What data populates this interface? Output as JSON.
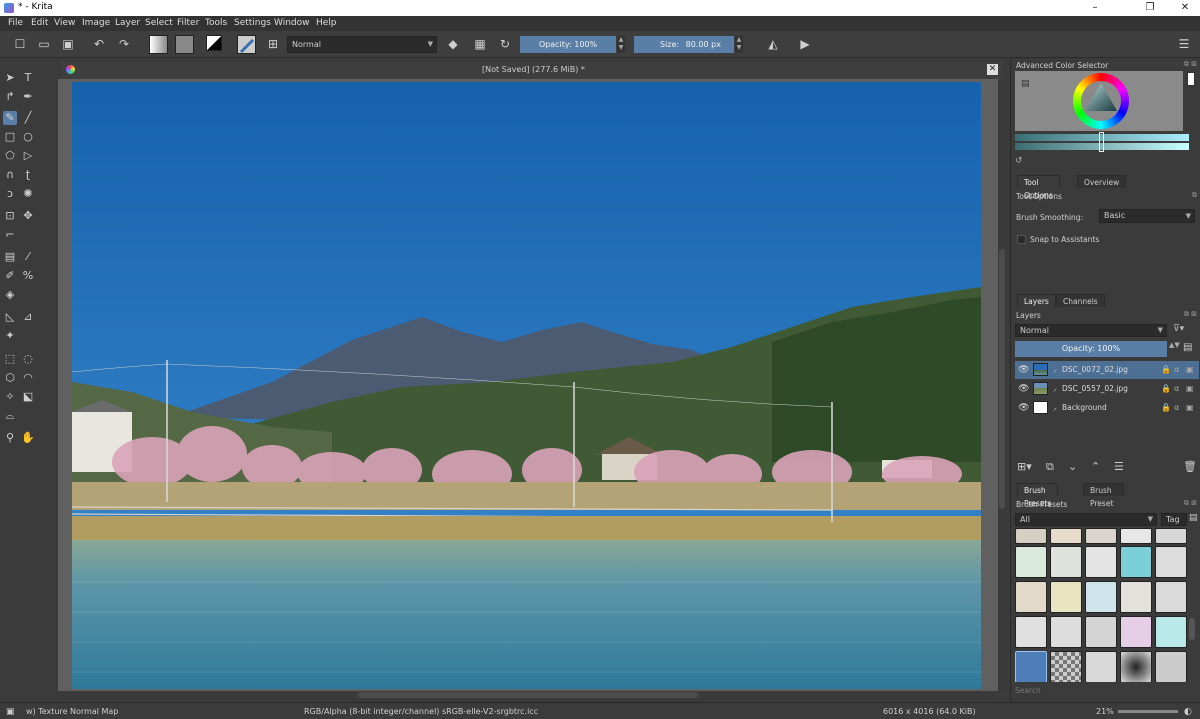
{
  "window": {
    "title": "* - Krita",
    "controls": [
      "–",
      "❐",
      "✕"
    ]
  },
  "menu": [
    "File",
    "Edit",
    "View",
    "Image",
    "Layer",
    "Select",
    "Filter",
    "Tools",
    "Settings",
    "Window",
    "Help"
  ],
  "toolbar": {
    "blend_mode": "Normal",
    "opacity_label": "Opacity: 100%",
    "size_label": "Size:",
    "size_value": "80.00 px"
  },
  "document": {
    "tab_title": "[Not Saved]  (277.6 MiB) *"
  },
  "advanced_color_selector": {
    "title": "Advanced Color Selector"
  },
  "tool_options": {
    "tabs": [
      "Tool Options",
      "Overview"
    ],
    "title": "Tool Options",
    "brush_smoothing_label": "Brush Smoothing:",
    "brush_smoothing_value": "Basic",
    "snap_label": "Snap to Assistants"
  },
  "layers_docker": {
    "tabs": [
      "Layers",
      "Channels"
    ],
    "title": "Layers",
    "blend_mode": "Normal",
    "opacity": "Opacity:  100%",
    "layers": [
      {
        "name": "DSC_0072_02.jpg",
        "selected": true
      },
      {
        "name": "DSC_0557_02.jpg",
        "selected": false
      },
      {
        "name": "Background",
        "selected": false
      }
    ]
  },
  "brush_presets_docker": {
    "tabs": [
      "Brush Presets",
      "Brush Preset History"
    ],
    "title": "Brush Presets",
    "filter": "All",
    "tag": "Tag",
    "search_placeholder": "Search"
  },
  "statusbar": {
    "brush": "w) Texture Normal Map",
    "colorspace": "RGB/Alpha (8-bit integer/channel)  sRGB-elle-V2-srgbtrc.icc",
    "dimensions": "6016 x 4016 (64.0 KiB)",
    "zoom": "21%"
  },
  "colors": {
    "accent": "#5a7fa6",
    "panel": "#3b3b3b",
    "sky": "#1f6fb8"
  }
}
